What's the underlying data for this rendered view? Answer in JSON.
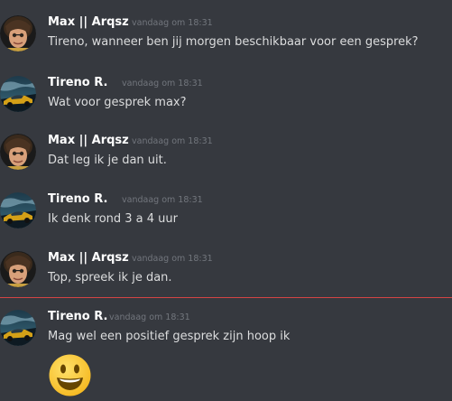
{
  "messages": [
    {
      "author": "Max || Arqsz",
      "timestamp": "vandaag om 18:31",
      "text": "Tireno, wanneer ben jij morgen beschikbaar voor een gesprek?"
    },
    {
      "author": "Tireno R.",
      "timestamp": "vandaag om 18:31",
      "text": "Wat voor gesprek max?"
    },
    {
      "author": "Max || Arqsz",
      "timestamp": "vandaag om 18:31",
      "text": "Dat leg ik je dan uit."
    },
    {
      "author": "Tireno R.",
      "timestamp": "vandaag om 18:31",
      "text": "Ik denk rond 3 a 4 uur"
    },
    {
      "author": "Max || Arqsz",
      "timestamp": "vandaag om 18:31",
      "text": "Top, spreek ik je dan."
    },
    {
      "author": "Tireno R.",
      "timestamp": "vandaag om 18:31",
      "text": "Mag wel een positief gesprek zijn hoop ik"
    }
  ],
  "emoji": "smiley-emoji",
  "colors": {
    "background": "#36393f",
    "author": "#ffffff",
    "timestamp": "#72767d",
    "text": "#dcddde",
    "new_messages_divider": "#f04747"
  }
}
